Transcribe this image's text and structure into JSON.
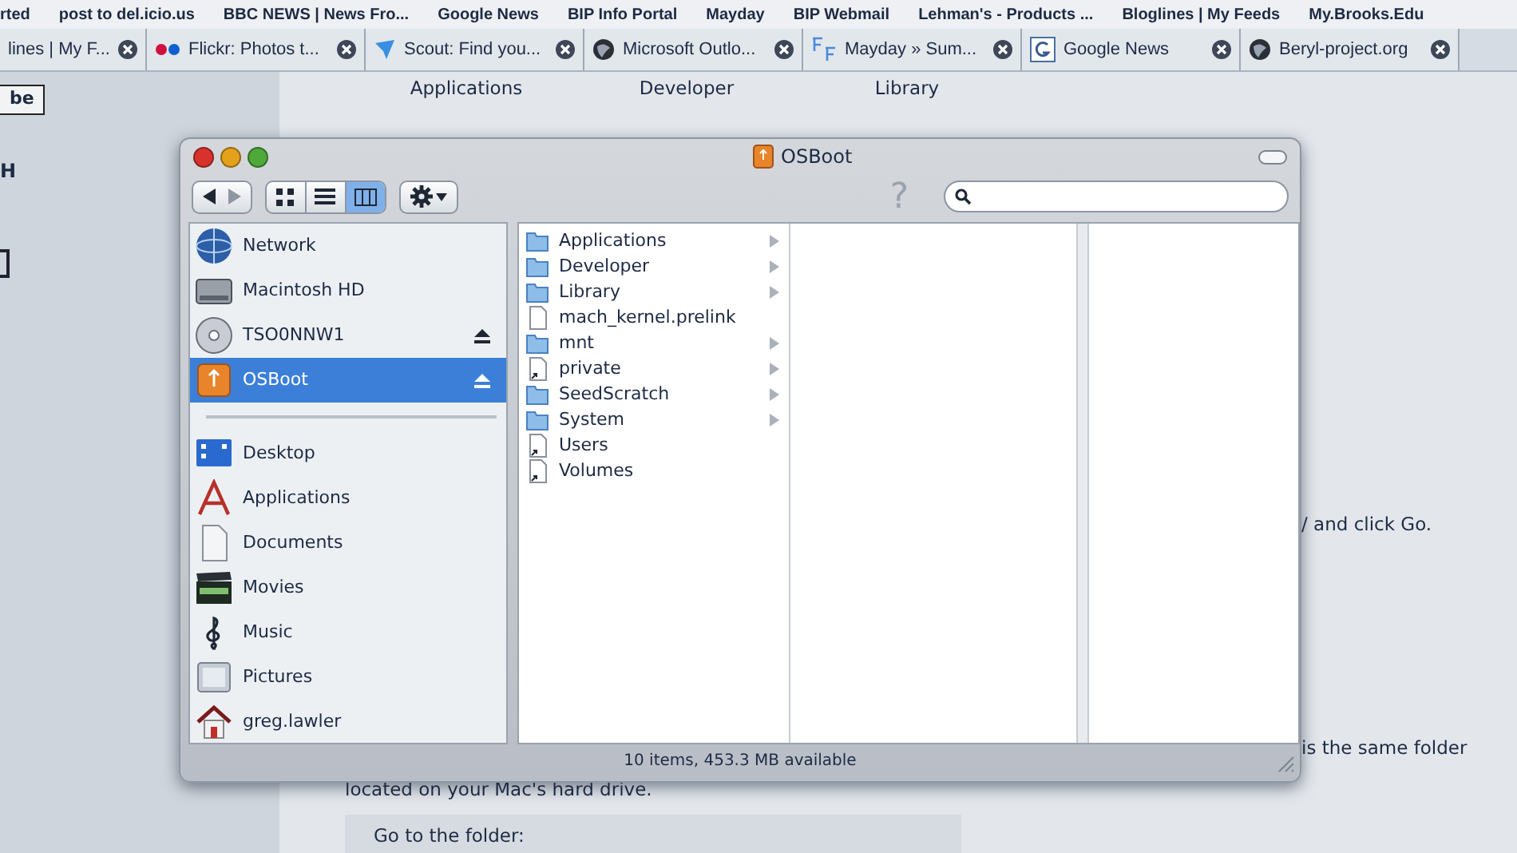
{
  "bookmarks_bar": [
    "rted",
    "post to del.icio.us",
    "BBC NEWS | News Fro...",
    "Google News",
    "BIP Info Portal",
    "Mayday",
    "BIP Webmail",
    "Lehman's - Products ...",
    "Bloglines | My Feeds",
    "My.Brooks.Edu"
  ],
  "tabs": [
    {
      "label": "lines | My F...",
      "kind": "none"
    },
    {
      "label": "Flickr: Photos t...",
      "kind": "dots"
    },
    {
      "label": "Scout: Find you...",
      "kind": "bird"
    },
    {
      "label": "Microsoft Outlo...",
      "kind": "globe"
    },
    {
      "label": "Mayday » Sum...",
      "kind": "letters"
    },
    {
      "label": "Google News",
      "kind": "letter"
    },
    {
      "label": "Beryl-project.org",
      "kind": "globe"
    }
  ],
  "page": {
    "nav": [
      "Applications",
      "Developer",
      "Library"
    ],
    "side_button": "be",
    "side_heading": "H",
    "text_1": "/ and click Go.",
    "text_2": "is the same folder",
    "text_3": "located on your Mac's hard drive.",
    "box_text": "Go to the folder:"
  },
  "finder": {
    "title": "OSBoot",
    "help_glyph": "?",
    "view_buttons": [
      {
        "kind": "icons",
        "selected": false
      },
      {
        "kind": "list",
        "selected": false
      },
      {
        "kind": "columns",
        "selected": true
      }
    ],
    "devices": [
      {
        "label": "Network",
        "kind": "network",
        "ejectable": false,
        "selected": false
      },
      {
        "label": "Macintosh HD",
        "kind": "disk",
        "ejectable": false,
        "selected": false
      },
      {
        "label": "TSO0NNW1",
        "kind": "cd",
        "ejectable": true,
        "selected": false
      },
      {
        "label": "OSBoot",
        "kind": "usb",
        "ejectable": true,
        "selected": true
      }
    ],
    "places": [
      {
        "label": "Desktop",
        "kind": "desktop",
        "selected": false
      },
      {
        "label": "Applications",
        "kind": "apps",
        "selected": false
      },
      {
        "label": "Documents",
        "kind": "documents",
        "selected": false
      },
      {
        "label": "Movies",
        "kind": "movies",
        "selected": false
      },
      {
        "label": "Music",
        "kind": "music",
        "selected": false
      },
      {
        "label": "Pictures",
        "kind": "pictures",
        "selected": false
      },
      {
        "label": "greg.lawler",
        "kind": "home",
        "selected": false
      }
    ],
    "column_1": [
      {
        "name": "Applications",
        "kind": "folder",
        "has_children": true
      },
      {
        "name": "Developer",
        "kind": "folder",
        "has_children": true
      },
      {
        "name": "Library",
        "kind": "folder",
        "has_children": true
      },
      {
        "name": "mach_kernel.prelink",
        "kind": "file",
        "has_children": false
      },
      {
        "name": "mnt",
        "kind": "folder",
        "has_children": true
      },
      {
        "name": "private",
        "kind": "alias",
        "has_children": true
      },
      {
        "name": "SeedScratch",
        "kind": "folder",
        "has_children": true
      },
      {
        "name": "System",
        "kind": "folder",
        "has_children": true
      },
      {
        "name": "Users",
        "kind": "alias",
        "has_children": false
      },
      {
        "name": "Volumes",
        "kind": "alias",
        "has_children": false
      }
    ],
    "status": "10 items, 453.3 MB available"
  }
}
